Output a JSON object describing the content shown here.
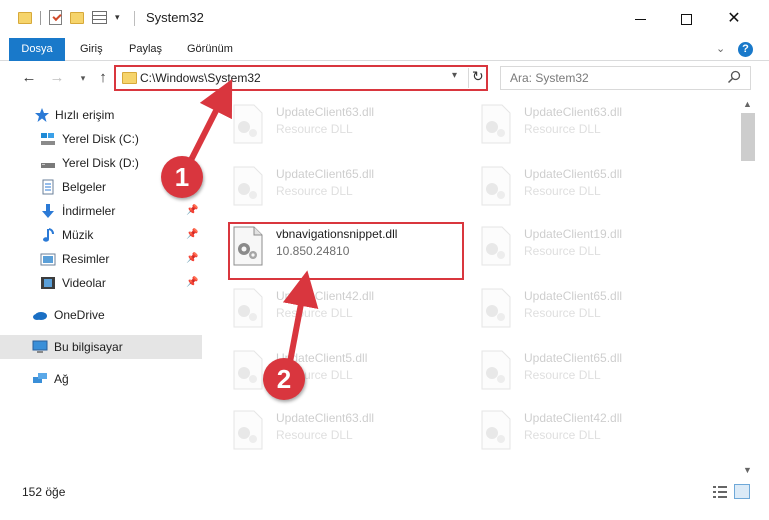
{
  "window": {
    "title": "System32",
    "minimize_glyph": "—",
    "maximize_glyph": "☐",
    "close_glyph": "✕"
  },
  "ribbon": {
    "tabs": [
      "Dosya",
      "Giriş",
      "Paylaş",
      "Görünüm"
    ],
    "help_glyph": "?",
    "accent_color": "#1979ca"
  },
  "nav": {
    "back_glyph": "←",
    "forward_glyph": "→",
    "recent_glyph": "▾",
    "up_glyph": "↑",
    "address": "C:\\Windows\\System32",
    "refresh_glyph": "↻",
    "search_placeholder": "Ara: System32"
  },
  "sidebar": {
    "quick_access": "Hızlı erişim",
    "items": [
      {
        "label": "Yerel Disk (C:)",
        "icon": "drive-c-icon",
        "pinned": false
      },
      {
        "label": "Yerel Disk (D:)",
        "icon": "drive-d-icon",
        "pinned": false
      },
      {
        "label": "Belgeler",
        "icon": "documents-icon",
        "pinned": true
      },
      {
        "label": "İndirmeler",
        "icon": "downloads-icon",
        "pinned": true
      },
      {
        "label": "Müzik",
        "icon": "music-icon",
        "pinned": true
      },
      {
        "label": "Resimler",
        "icon": "pictures-icon",
        "pinned": true
      },
      {
        "label": "Videolar",
        "icon": "videos-icon",
        "pinned": true
      }
    ],
    "onedrive": "OneDrive",
    "this_pc": "Bu bilgisayar",
    "network": "Ağ"
  },
  "files": {
    "left_column": [
      {
        "name": "UpdateClient63.dll",
        "type": "Resource DLL"
      },
      {
        "name": "UpdateClient65.dll",
        "type": "Resource DLL"
      },
      {
        "name": "vbnavigationsnippet.dll",
        "type": "10.850.24810"
      },
      {
        "name": "UpdateClient42.dll",
        "type": "Resource DLL"
      },
      {
        "name": "UpdateClient5.dll",
        "type": "Resource DLL"
      },
      {
        "name": "UpdateClient63.dll",
        "type": "Resource DLL"
      }
    ],
    "right_column": [
      {
        "name": "UpdateClient63.dll",
        "type": "Resource DLL"
      },
      {
        "name": "UpdateClient65.dll",
        "type": "Resource DLL"
      },
      {
        "name": "UpdateClient19.dll",
        "type": "Resource DLL"
      },
      {
        "name": "UpdateClient65.dll",
        "type": "Resource DLL"
      },
      {
        "name": "UpdateClient65.dll",
        "type": "Resource DLL"
      },
      {
        "name": "UpdateClient42.dll",
        "type": "Resource DLL"
      }
    ]
  },
  "status": {
    "item_count": "152 öğe"
  },
  "annotations": {
    "step1": "1",
    "step2": "2",
    "color": "#d9363e"
  }
}
